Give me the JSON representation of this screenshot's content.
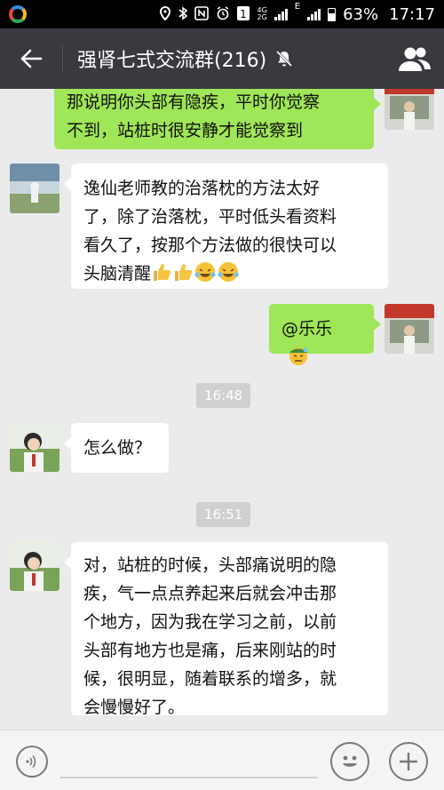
{
  "status_bar": {
    "network_top": "4G",
    "network_bottom": "2G",
    "data_indicator": "E",
    "battery_percent": "63%",
    "time": "17:17"
  },
  "header": {
    "title": "强肾七式交流群(216)"
  },
  "messages": [
    {
      "direction": "out",
      "lines": [
        "那说明你头部有隐疾，平时你觉察",
        "不到，站桩时很安静才能觉察到"
      ]
    },
    {
      "direction": "in",
      "lines": [
        "逸仙老师教的治落枕的方法太好",
        "了，除了治落枕，平时低头看资料",
        "看久了，按那个方法做的很快可以",
        "头脑清醒"
      ],
      "emojis": [
        "thumbs-up",
        "thumbs-up",
        "laughing-tears",
        "laughing-tears"
      ]
    },
    {
      "direction": "out",
      "lines": [
        "@乐乐"
      ],
      "emoji": "sweat-face"
    },
    {
      "time": "16:48"
    },
    {
      "direction": "in",
      "lines": [
        "怎么做？"
      ]
    },
    {
      "time": "16:51"
    },
    {
      "direction": "in",
      "lines": [
        "对，站桩的时候，头部痛说明的隐",
        "疾，气一点点养起来后就会冲击那",
        "个地方，因为我在学习之前，以前",
        "头部有地方也是痛，后来刚站的时",
        "候，很明显，随着联系的增多，就",
        "会慢慢好了。"
      ]
    }
  ],
  "input_bar": {
    "placeholder": ""
  },
  "colors": {
    "header_bg": "#393a3f",
    "chat_bg": "#ebebeb",
    "outgoing_bubble": "#9fe658",
    "incoming_bubble": "#ffffff"
  }
}
